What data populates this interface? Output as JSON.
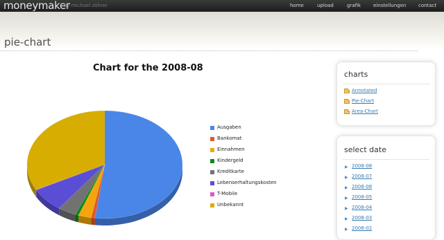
{
  "app": {
    "logo": "moneymaker",
    "byline": "by michael zöhrer"
  },
  "nav": {
    "home": "home",
    "upload": "upload",
    "grafik": "grafik",
    "einstellungen": "einstellungen",
    "contact": "contact"
  },
  "page": {
    "title": "pie-chart"
  },
  "chart_data": {
    "type": "pie",
    "title": "Chart for the 2008-08",
    "categories": [
      "Ausgaben",
      "Bankomat",
      "Einnahmen",
      "Kindergeld",
      "Kreditkarte",
      "Lebenserhaltungskosten",
      "T-Mobile",
      "Unbekannt"
    ],
    "values": [
      52,
      0.8,
      2.7,
      0.7,
      3.8,
      7.2,
      0.1,
      32.7
    ],
    "colors": [
      "#4a86e8",
      "#e05a2a",
      "#f4a50d",
      "#0a8b1b",
      "#727272",
      "#5a4ed6",
      "#d65acb",
      "#d6ad00"
    ],
    "legend_position": "right"
  },
  "sidebar": {
    "charts": {
      "title": "charts",
      "items": [
        "Annotated",
        "Pie-Chart",
        "Area-Chart"
      ]
    },
    "dates": {
      "title": "select date",
      "items": [
        "2008-08",
        "2008-07",
        "2008-08",
        "2008-05",
        "2008-04",
        "2008-03",
        "2008-02"
      ]
    }
  }
}
